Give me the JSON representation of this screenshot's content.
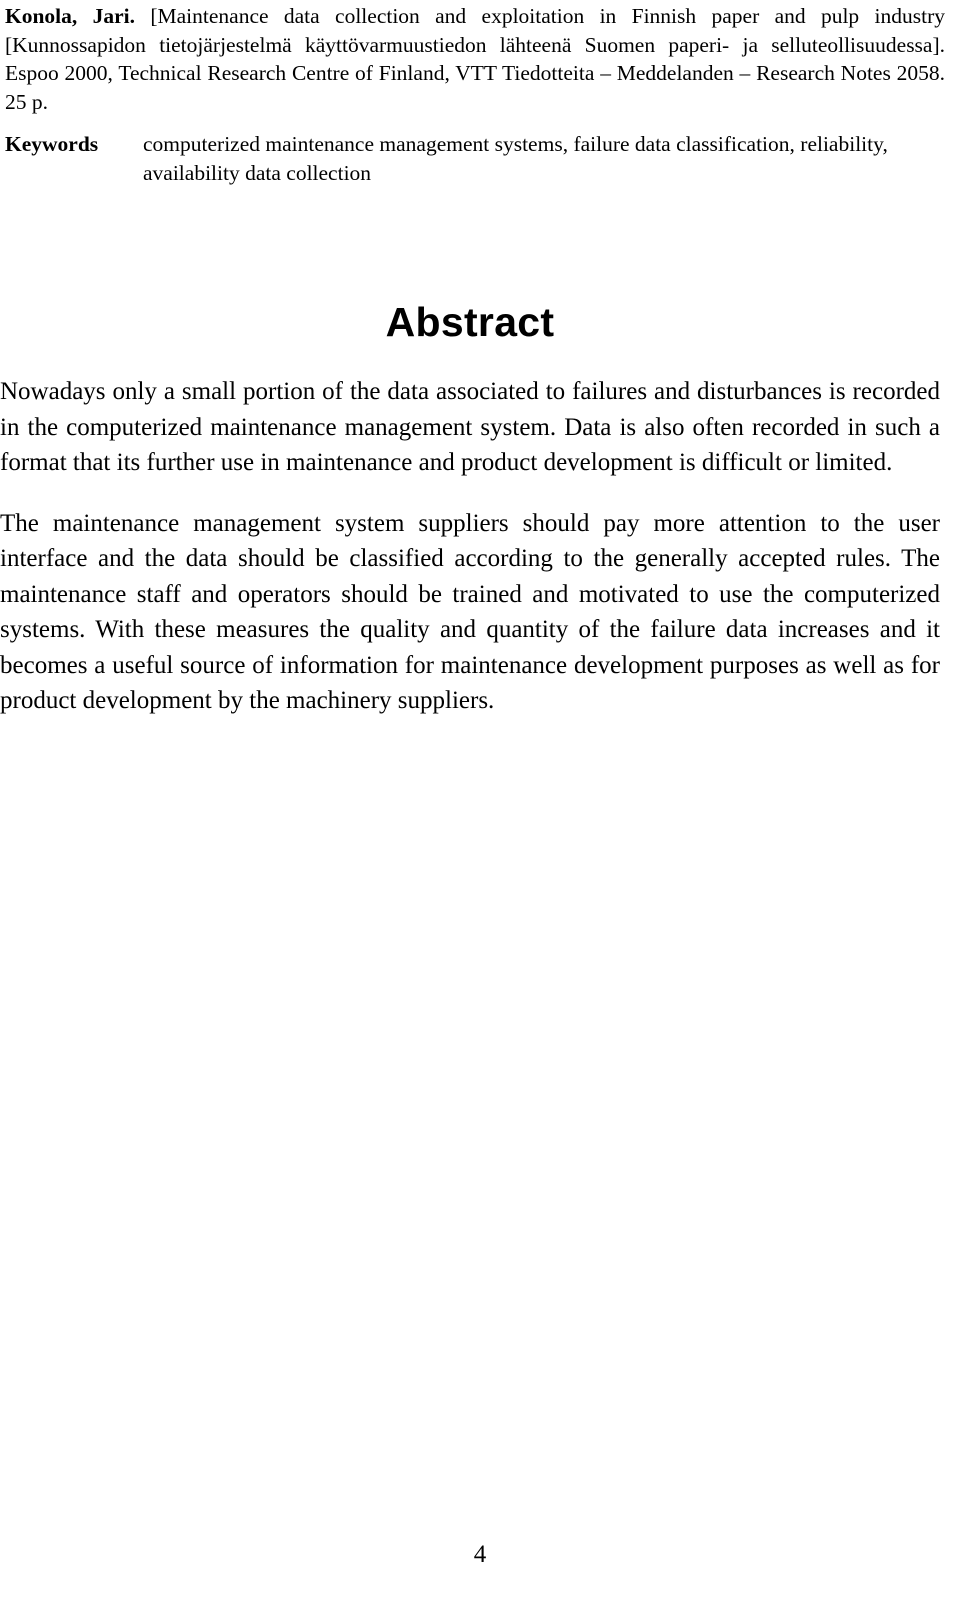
{
  "document": {
    "page_number": "4",
    "biblio": {
      "author": "Konola, Jari.",
      "citation": " [Maintenance data collection and exploitation in Finnish paper and pulp industry [Kunnossapidon tietojärjestelmä käyttövarmuustiedon lähteenä Suomen paperi- ja selluteollisuudessa]. Espoo 2000, Technical Research Centre of Finland, VTT Tiedotteita – Meddelanden – Research Notes 2058. 25 p."
    },
    "keywords": {
      "label": "Keywords",
      "value": "computerized maintenance management systems, failure data classification, reliability, availability data collection"
    },
    "abstract": {
      "heading": "Abstract",
      "paragraphs": [
        "Nowadays only a small portion of the data associated to failures and disturbances is recorded in the computerized maintenance management system. Data is also often recorded in such a format that its further use in maintenance and product development is difficult or limited.",
        "The maintenance management system suppliers should pay more attention to the user interface and the data should be classified according to the generally accepted rules. The maintenance staff and operators should be trained and motivated to use the computerized systems. With these measures the quality and quantity of the failure data increases and it becomes a useful source of information for maintenance development purposes as well as for product development by the machinery suppliers."
      ]
    }
  }
}
